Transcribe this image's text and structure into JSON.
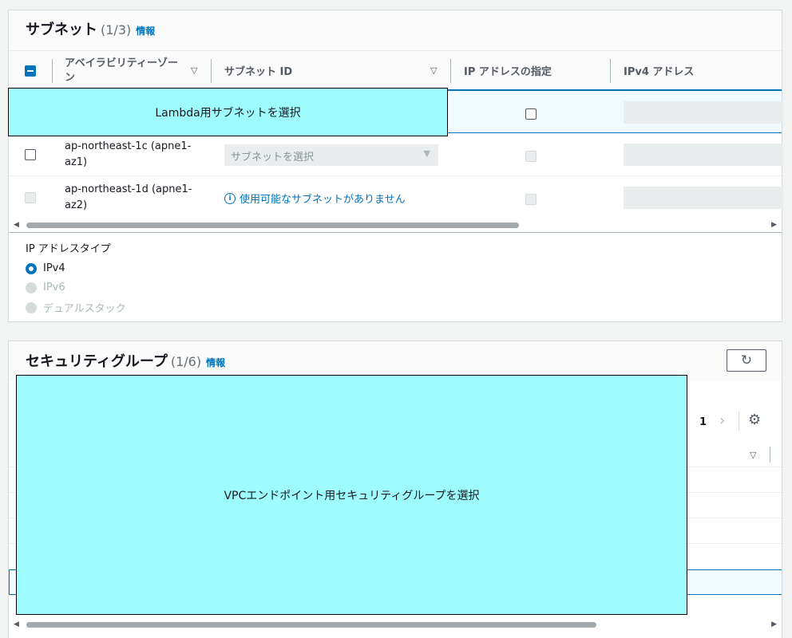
{
  "subnets": {
    "title": "サブネット",
    "count": "(1/3)",
    "info_link": "情報",
    "columns": [
      "アベイラビリティーゾーン",
      "サブネット ID",
      "IP アドレスの指定",
      "IPv4 アドレス"
    ],
    "rows": [
      {
        "az": "ap-northeast-1c (apne1-az1)",
        "subnet_placeholder": "サブネットを選択"
      },
      {
        "az": "ap-northeast-1d (apne1-az2)",
        "no_subnet_message": "使用可能なサブネットがありません"
      }
    ],
    "ip_address_type": {
      "label": "IP アドレスタイプ",
      "options": [
        {
          "label": "IPv4",
          "selected": true,
          "disabled": false
        },
        {
          "label": "IPv6",
          "selected": false,
          "disabled": true
        },
        {
          "label": "デュアルスタック",
          "selected": false,
          "disabled": true
        }
      ]
    },
    "overlay_label": "Lambda用サブネットを選択"
  },
  "security_groups": {
    "title": "セキュリティグループ",
    "count": "(1/6)",
    "info_link": "情報",
    "page_number": "1",
    "overlay_label": "VPCエンドポイント用セキュリティグループを選択"
  },
  "colors": {
    "accent": "#0073bb",
    "overlay": "#9efcfe",
    "selected_row": "#f1faff"
  }
}
